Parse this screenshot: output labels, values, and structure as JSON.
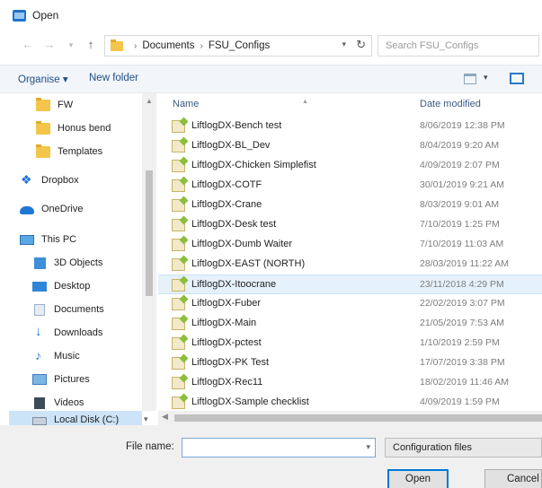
{
  "window": {
    "title": "Open"
  },
  "address": {
    "crumbs": [
      "Documents",
      "FSU_Configs"
    ],
    "separator": "›",
    "search_placeholder": "Search FSU_Configs"
  },
  "toolbar": {
    "organise": "Organise ▾",
    "new_folder": "New folder"
  },
  "nav": {
    "items": [
      {
        "label": "FW",
        "icon": "folder-icon"
      },
      {
        "label": "Honus bend",
        "icon": "folder-icon"
      },
      {
        "label": "Templates",
        "icon": "folder-icon"
      },
      {
        "label": "Dropbox",
        "icon": "dropbox-icon"
      },
      {
        "label": "OneDrive",
        "icon": "onedrive-icon"
      },
      {
        "label": "This PC",
        "icon": "computer-icon"
      },
      {
        "label": "3D Objects",
        "icon": "cube-icon"
      },
      {
        "label": "Desktop",
        "icon": "desktop-icon"
      },
      {
        "label": "Documents",
        "icon": "document-icon"
      },
      {
        "label": "Downloads",
        "icon": "download-icon"
      },
      {
        "label": "Music",
        "icon": "music-icon"
      },
      {
        "label": "Pictures",
        "icon": "pictures-icon"
      },
      {
        "label": "Videos",
        "icon": "videos-icon"
      },
      {
        "label": "Local Disk (C:)",
        "icon": "disk-icon"
      }
    ]
  },
  "files": {
    "columns": {
      "name": "Name",
      "date": "Date modified"
    },
    "rows": [
      {
        "name": "LiftlogDX-Bench test",
        "date": "8/06/2019 12:38 PM"
      },
      {
        "name": "LiftlogDX-BL_Dev",
        "date": "8/04/2019 9:20 AM"
      },
      {
        "name": "LiftlogDX-Chicken Simplefist",
        "date": "4/09/2019 2:07 PM"
      },
      {
        "name": "LiftlogDX-COTF",
        "date": "30/01/2019 9:21 AM"
      },
      {
        "name": "LiftlogDX-Crane",
        "date": "8/03/2019 9:01 AM"
      },
      {
        "name": "LiftlogDX-Desk test",
        "date": "7/10/2019 1:25 PM"
      },
      {
        "name": "LiftlogDX-Dumb Waiter",
        "date": "7/10/2019 11:03 AM"
      },
      {
        "name": "LiftlogDX-EAST (NORTH)",
        "date": "28/03/2019 11:22 AM"
      },
      {
        "name": "LiftlogDX-Itoocrane",
        "date": "23/11/2018 4:29 PM"
      },
      {
        "name": "LiftlogDX-Fuber",
        "date": "22/02/2019 3:07 PM"
      },
      {
        "name": "LiftlogDX-Main",
        "date": "21/05/2019 7:53 AM"
      },
      {
        "name": "LiftlogDX-pctest",
        "date": "1/10/2019 2:59 PM"
      },
      {
        "name": "LiftlogDX-PK Test",
        "date": "17/07/2019 3:38 PM"
      },
      {
        "name": "LiftlogDX-Rec11",
        "date": "18/02/2019 11:46 AM"
      },
      {
        "name": "LiftlogDX-Sample checklist",
        "date": "4/09/2019 1:59 PM"
      }
    ],
    "selected_index": 8
  },
  "bottom": {
    "file_name_label": "File name:",
    "file_name_value": "",
    "filter": "Configuration files",
    "open_label": "Open",
    "cancel_label": "Cancel"
  }
}
